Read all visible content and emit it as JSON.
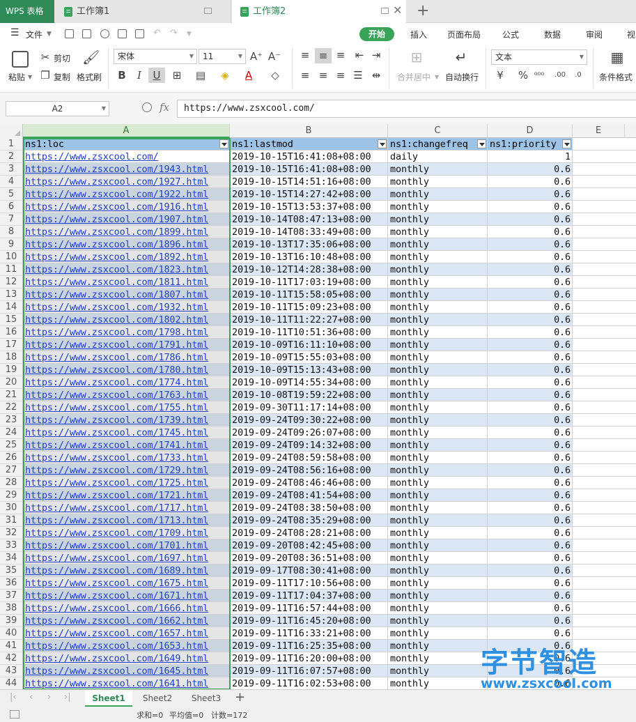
{
  "app": {
    "name": "WPS 表格",
    "tabs": [
      {
        "label": "工作簿1",
        "active": false
      },
      {
        "label": "工作簿2",
        "active": true
      }
    ]
  },
  "menu": {
    "file": "文件",
    "tabs": [
      "开始",
      "插入",
      "页面布局",
      "公式",
      "数据",
      "审阅",
      "视"
    ],
    "active_tab": "开始"
  },
  "ribbon": {
    "paste": "粘贴",
    "cut": "剪切",
    "copy": "复制",
    "format_painter": "格式刷",
    "font_name": "宋体",
    "font_size": "11",
    "merge_center": "合并居中",
    "wrap_text": "自动换行",
    "number_format": "文本",
    "conditional_format": "条件格式"
  },
  "formula_bar": {
    "name_box": "A2",
    "fx": "fx",
    "value": "https://www.zsxcool.com/"
  },
  "columns": [
    "A",
    "B",
    "C",
    "D",
    "E"
  ],
  "header_row": [
    "ns1:loc",
    "ns1:lastmod",
    "ns1:changefreq",
    "ns1:priority"
  ],
  "rows": [
    [
      "https://www.zsxcool.com/",
      "2019-10-15T16:41:08+08:00",
      "daily",
      "1"
    ],
    [
      "https://www.zsxcool.com/1943.html",
      "2019-10-15T16:41:08+08:00",
      "monthly",
      "0.6"
    ],
    [
      "https://www.zsxcool.com/1927.html",
      "2019-10-15T14:51:16+08:00",
      "monthly",
      "0.6"
    ],
    [
      "https://www.zsxcool.com/1922.html",
      "2019-10-15T14:27:42+08:00",
      "monthly",
      "0.6"
    ],
    [
      "https://www.zsxcool.com/1916.html",
      "2019-10-15T13:53:37+08:00",
      "monthly",
      "0.6"
    ],
    [
      "https://www.zsxcool.com/1907.html",
      "2019-10-14T08:47:13+08:00",
      "monthly",
      "0.6"
    ],
    [
      "https://www.zsxcool.com/1899.html",
      "2019-10-14T08:33:49+08:00",
      "monthly",
      "0.6"
    ],
    [
      "https://www.zsxcool.com/1896.html",
      "2019-10-13T17:35:06+08:00",
      "monthly",
      "0.6"
    ],
    [
      "https://www.zsxcool.com/1892.html",
      "2019-10-13T16:10:48+08:00",
      "monthly",
      "0.6"
    ],
    [
      "https://www.zsxcool.com/1823.html",
      "2019-10-12T14:28:38+08:00",
      "monthly",
      "0.6"
    ],
    [
      "https://www.zsxcool.com/1811.html",
      "2019-10-11T17:03:19+08:00",
      "monthly",
      "0.6"
    ],
    [
      "https://www.zsxcool.com/1807.html",
      "2019-10-11T15:58:05+08:00",
      "monthly",
      "0.6"
    ],
    [
      "https://www.zsxcool.com/1932.html",
      "2019-10-11T15:09:23+08:00",
      "monthly",
      "0.6"
    ],
    [
      "https://www.zsxcool.com/1802.html",
      "2019-10-11T11:22:27+08:00",
      "monthly",
      "0.6"
    ],
    [
      "https://www.zsxcool.com/1798.html",
      "2019-10-11T10:51:36+08:00",
      "monthly",
      "0.6"
    ],
    [
      "https://www.zsxcool.com/1791.html",
      "2019-10-09T16:11:10+08:00",
      "monthly",
      "0.6"
    ],
    [
      "https://www.zsxcool.com/1786.html",
      "2019-10-09T15:55:03+08:00",
      "monthly",
      "0.6"
    ],
    [
      "https://www.zsxcool.com/1780.html",
      "2019-10-09T15:13:43+08:00",
      "monthly",
      "0.6"
    ],
    [
      "https://www.zsxcool.com/1774.html",
      "2019-10-09T14:55:34+08:00",
      "monthly",
      "0.6"
    ],
    [
      "https://www.zsxcool.com/1763.html",
      "2019-10-08T19:59:22+08:00",
      "monthly",
      "0.6"
    ],
    [
      "https://www.zsxcool.com/1755.html",
      "2019-09-30T11:17:14+08:00",
      "monthly",
      "0.6"
    ],
    [
      "https://www.zsxcool.com/1739.html",
      "2019-09-24T09:30:22+08:00",
      "monthly",
      "0.6"
    ],
    [
      "https://www.zsxcool.com/1745.html",
      "2019-09-24T09:26:07+08:00",
      "monthly",
      "0.6"
    ],
    [
      "https://www.zsxcool.com/1741.html",
      "2019-09-24T09:14:32+08:00",
      "monthly",
      "0.6"
    ],
    [
      "https://www.zsxcool.com/1733.html",
      "2019-09-24T08:59:58+08:00",
      "monthly",
      "0.6"
    ],
    [
      "https://www.zsxcool.com/1729.html",
      "2019-09-24T08:56:16+08:00",
      "monthly",
      "0.6"
    ],
    [
      "https://www.zsxcool.com/1725.html",
      "2019-09-24T08:46:46+08:00",
      "monthly",
      "0.6"
    ],
    [
      "https://www.zsxcool.com/1721.html",
      "2019-09-24T08:41:54+08:00",
      "monthly",
      "0.6"
    ],
    [
      "https://www.zsxcool.com/1717.html",
      "2019-09-24T08:38:50+08:00",
      "monthly",
      "0.6"
    ],
    [
      "https://www.zsxcool.com/1713.html",
      "2019-09-24T08:35:29+08:00",
      "monthly",
      "0.6"
    ],
    [
      "https://www.zsxcool.com/1709.html",
      "2019-09-24T08:28:21+08:00",
      "monthly",
      "0.6"
    ],
    [
      "https://www.zsxcool.com/1701.html",
      "2019-09-20T08:42:45+08:00",
      "monthly",
      "0.6"
    ],
    [
      "https://www.zsxcool.com/1697.html",
      "2019-09-20T08:36:51+08:00",
      "monthly",
      "0.6"
    ],
    [
      "https://www.zsxcool.com/1689.html",
      "2019-09-17T08:30:41+08:00",
      "monthly",
      "0.6"
    ],
    [
      "https://www.zsxcool.com/1675.html",
      "2019-09-11T17:10:56+08:00",
      "monthly",
      "0.6"
    ],
    [
      "https://www.zsxcool.com/1671.html",
      "2019-09-11T17:04:37+08:00",
      "monthly",
      "0.6"
    ],
    [
      "https://www.zsxcool.com/1666.html",
      "2019-09-11T16:57:44+08:00",
      "monthly",
      "0.6"
    ],
    [
      "https://www.zsxcool.com/1662.html",
      "2019-09-11T16:45:20+08:00",
      "monthly",
      "0.6"
    ],
    [
      "https://www.zsxcool.com/1657.html",
      "2019-09-11T16:33:21+08:00",
      "monthly",
      "0.6"
    ],
    [
      "https://www.zsxcool.com/1653.html",
      "2019-09-11T16:25:35+08:00",
      "monthly",
      "0.6"
    ],
    [
      "https://www.zsxcool.com/1649.html",
      "2019-09-11T16:20:00+08:00",
      "monthly",
      "0.6"
    ],
    [
      "https://www.zsxcool.com/1645.html",
      "2019-09-11T16:07:57+08:00",
      "monthly",
      "0.6"
    ],
    [
      "https://www.zsxcool.com/1641.html",
      "2019-09-11T16:02:53+08:00",
      "monthly",
      "0.6"
    ]
  ],
  "sheets": [
    "Sheet1",
    "Sheet2",
    "Sheet3"
  ],
  "active_sheet": "Sheet1",
  "status": {
    "sum": "求和=0",
    "average": "平均值=0",
    "count": "计数=172"
  },
  "watermark": {
    "text": "字节智造",
    "url": "www.zsxcool.com"
  },
  "colors": {
    "accent": "#3aa35a",
    "header_fill": "#9dc3e6",
    "band_fill": "#dbe7f5",
    "link": "#1f3fcf",
    "watermark": "#2f8fe0"
  }
}
